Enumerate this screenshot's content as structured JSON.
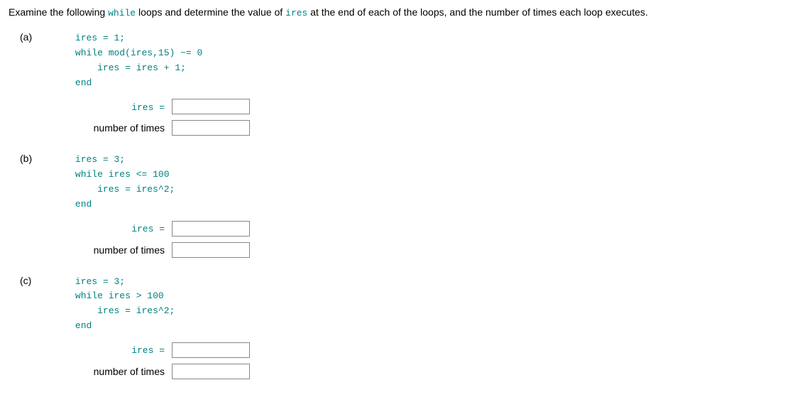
{
  "instruction": {
    "prefix": "Examine the following ",
    "code1": "while",
    "mid1": " loops and determine the value of ",
    "code2": "ires",
    "suffix": " at the end of each of the loops, and the number of times each loop executes."
  },
  "problems": [
    {
      "label": "(a)",
      "code": [
        "ires = 1;",
        "while mod(ires,15) ~= 0",
        "    ires = ires + 1;",
        "end"
      ],
      "answers": [
        {
          "labelPrefix": "",
          "labelCode": "ires =",
          "value": ""
        },
        {
          "labelPrefix": "number of times",
          "labelCode": "",
          "value": ""
        }
      ]
    },
    {
      "label": "(b)",
      "code": [
        "ires = 3;",
        "while ires <= 100",
        "    ires = ires^2;",
        "end"
      ],
      "answers": [
        {
          "labelPrefix": "",
          "labelCode": "ires =",
          "value": ""
        },
        {
          "labelPrefix": "number of times",
          "labelCode": "",
          "value": ""
        }
      ]
    },
    {
      "label": "(c)",
      "code": [
        "ires = 3;",
        "while ires > 100",
        "    ires = ires^2;",
        "end"
      ],
      "answers": [
        {
          "labelPrefix": "",
          "labelCode": "ires =",
          "value": ""
        },
        {
          "labelPrefix": "number of times",
          "labelCode": "",
          "value": ""
        }
      ]
    }
  ]
}
